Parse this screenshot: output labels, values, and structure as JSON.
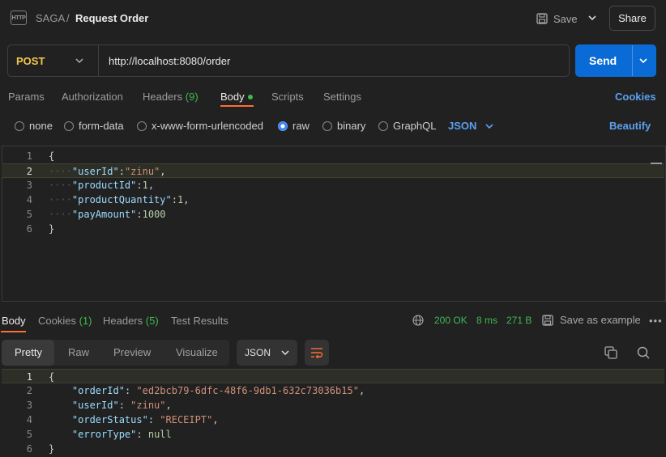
{
  "breadcrumb": {
    "collection": "SAGA",
    "separator": "/",
    "title": "Request Order"
  },
  "header": {
    "save_label": "Save",
    "share_label": "Share"
  },
  "request": {
    "method": "POST",
    "url": "http://localhost:8080/order",
    "send_label": "Send"
  },
  "tabs": {
    "params": "Params",
    "authorization": "Authorization",
    "headers": "Headers",
    "headers_count": "(9)",
    "body": "Body",
    "scripts": "Scripts",
    "settings": "Settings",
    "cookies": "Cookies"
  },
  "body_types": [
    "none",
    "form-data",
    "x-www-form-urlencoded",
    "raw",
    "binary",
    "GraphQL"
  ],
  "body_format": "JSON",
  "beautify_label": "Beautify",
  "request_body": {
    "line_numbers": [
      "1",
      "2",
      "3",
      "4",
      "5",
      "6"
    ],
    "lines": [
      {
        "text": "{"
      },
      {
        "key": "\"userId\"",
        "sep": ":",
        "value": "\"zinu\"",
        "end": ","
      },
      {
        "key": "\"productId\"",
        "sep": ":",
        "value": "1",
        "end": ","
      },
      {
        "key": "\"productQuantity\"",
        "sep": ":",
        "value": "1",
        "end": ","
      },
      {
        "key": "\"payAmount\"",
        "sep": ":",
        "value": "1000",
        "end": ""
      },
      {
        "text": "}"
      }
    ]
  },
  "response": {
    "tabs": {
      "body": "Body",
      "cookies": "Cookies",
      "cookies_count": "(1)",
      "headers": "Headers",
      "headers_count": "(5)",
      "test_results": "Test Results"
    },
    "status": "200 OK",
    "time": "8 ms",
    "size": "271 B",
    "save_example_label": "Save as example",
    "more_label": "•••",
    "views": [
      "Pretty",
      "Raw",
      "Preview",
      "Visualize"
    ],
    "format": "JSON",
    "line_numbers": [
      "1",
      "2",
      "3",
      "4",
      "5",
      "6"
    ],
    "lines": [
      {
        "text": "{"
      },
      {
        "key": "\"orderId\"",
        "sep": ": ",
        "value": "\"ed2bcb79-6dfc-48f6-9db1-632c73036b15\"",
        "end": ","
      },
      {
        "key": "\"userId\"",
        "sep": ": ",
        "value": "\"zinu\"",
        "end": ","
      },
      {
        "key": "\"orderStatus\"",
        "sep": ": ",
        "value": "\"RECEIPT\"",
        "end": ","
      },
      {
        "key": "\"errorType\"",
        "sep": ": ",
        "value": "null",
        "end": ""
      },
      {
        "text": "}"
      }
    ]
  },
  "colors": {
    "accent": "#ff6c37",
    "send": "#0b6bd6",
    "link": "#5aa0f0",
    "success": "#3fb950",
    "method": "#f2c94c"
  }
}
